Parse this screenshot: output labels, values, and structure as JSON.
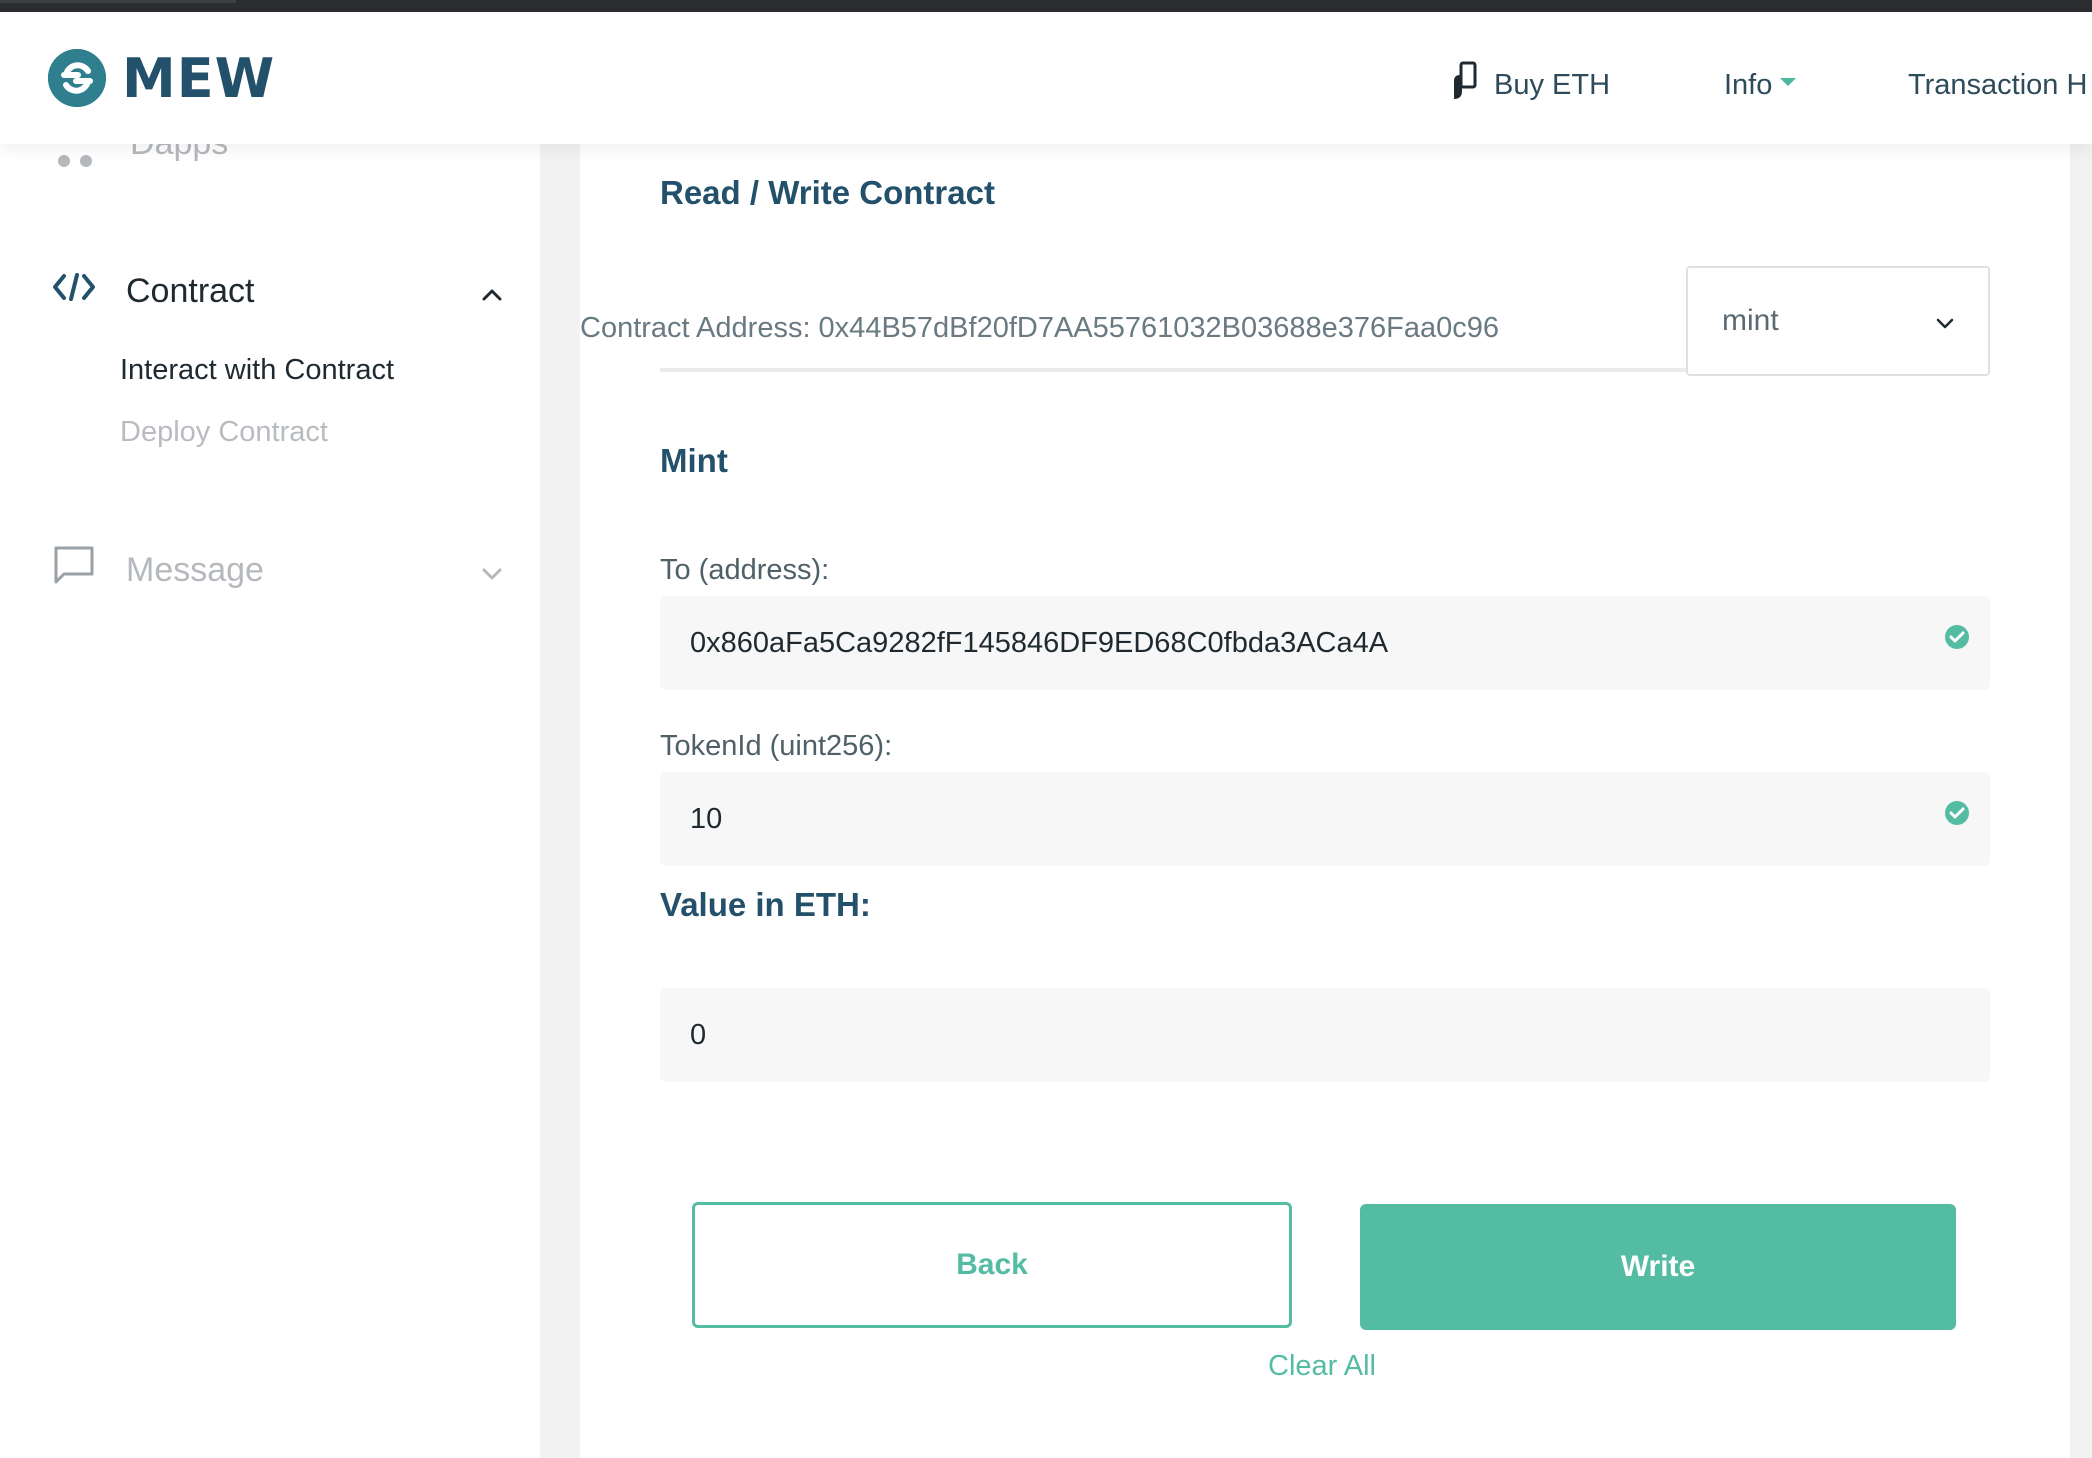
{
  "header": {
    "logo_text": "MEW",
    "nav": {
      "buy_eth": "Buy ETH",
      "info": "Info",
      "transaction_history": "Transaction H"
    }
  },
  "sidebar": {
    "faded_item": "Dapps",
    "contract": {
      "label": "Contract",
      "sub_items": [
        {
          "label": "Interact with Contract",
          "active": true
        },
        {
          "label": "Deploy Contract",
          "active": false
        }
      ]
    },
    "message": {
      "label": "Message"
    }
  },
  "main": {
    "title": "Read / Write Contract",
    "contract_address_label": "Contract Address: 0x44B57dBf20fD7AA55761032B03688e376Faa0c96",
    "function_select": {
      "selected": "mint"
    },
    "function_title": "Mint",
    "fields": [
      {
        "label": "To (address):",
        "value": "0x860aFa5Ca9282fF145846DF9ED68C0fbda3ACa4A",
        "valid": true
      },
      {
        "label": "TokenId (uint256):",
        "value": "10",
        "valid": true
      }
    ],
    "value_title": "Value in ETH:",
    "value_input": "0",
    "buttons": {
      "back": "Back",
      "write": "Write",
      "clear_all": "Clear All"
    }
  },
  "colors": {
    "accent": "#55bca4",
    "heading": "#23506a",
    "logo": "#2f7f8e"
  }
}
